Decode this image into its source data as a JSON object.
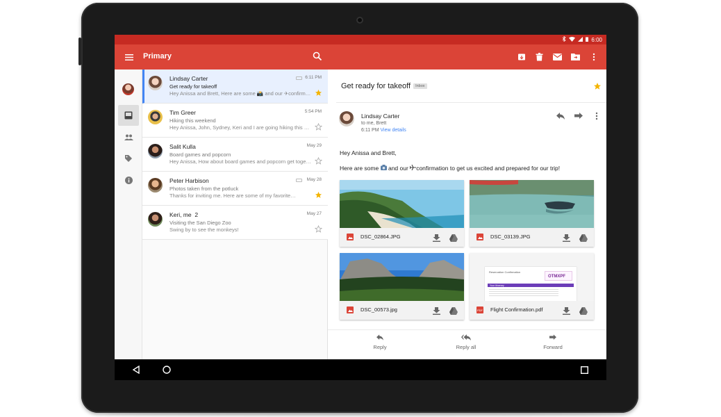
{
  "status_bar": {
    "time": "6:00"
  },
  "app_bar": {
    "title": "Primary"
  },
  "threads": [
    {
      "sender": "Lindsay Carter",
      "subject": "Get ready for takeoff",
      "snippet": "Hey Anissa and Brett, Here are some 📸 and our ✈confirma…",
      "time": "6:11 PM",
      "starred": true
    },
    {
      "sender": "Tim Greer",
      "subject": "Hiking this weekend",
      "snippet": "Hey Anissa, John, Sydney, Keri and I are going hiking this we…",
      "time": "5:54 PM",
      "starred": false
    },
    {
      "sender": "Salit Kulla",
      "subject": "Board games and popcorn",
      "snippet": "Hey Anissa, How about board games and popcorn get toge…",
      "time": "May 29",
      "starred": false
    },
    {
      "sender": "Peter Harbison",
      "subject": "Photos taken from the potluck",
      "snippet": "Thanks for inviting me. Here are some of my favorite…",
      "time": "May 28",
      "starred": true
    },
    {
      "sender": "Keri, me",
      "count": "2",
      "subject": "Visiting the San Diego Zoo",
      "snippet": "Swing by to see the monkeys!",
      "time": "May 27",
      "starred": false
    }
  ],
  "detail": {
    "subject": "Get ready for takeoff",
    "label": "Inbox",
    "from": "Lindsay Carter",
    "to": "to me, Brett",
    "time": "6:11 PM",
    "view_details": "View details",
    "greeting": "Hey Anissa and Brett,",
    "body_pre": "Here are some",
    "body_mid": "and our",
    "body_post": "confirmation to get us excited and prepared for our trip!",
    "attachments": [
      {
        "name": "DSC_02864.JPG",
        "type": "image"
      },
      {
        "name": "DSC_03139.JPG",
        "type": "image"
      },
      {
        "name": "DSC_00573.jpg",
        "type": "image"
      },
      {
        "name": "Flight Confirmation.pdf",
        "type": "pdf",
        "type_label": "PDF"
      }
    ],
    "pdf_preview": {
      "heading": "Reservation Confirmation",
      "code": "OTMXPF",
      "section": "Your Itinerary"
    },
    "actions": {
      "reply": "Reply",
      "reply_all": "Reply all",
      "forward": "Forward"
    }
  },
  "colors": {
    "brand_red": "#db4437",
    "status_red": "#c62a22",
    "star": "#f4b400",
    "link_blue": "#4285f4",
    "selected_bg": "#e8f0fe"
  }
}
